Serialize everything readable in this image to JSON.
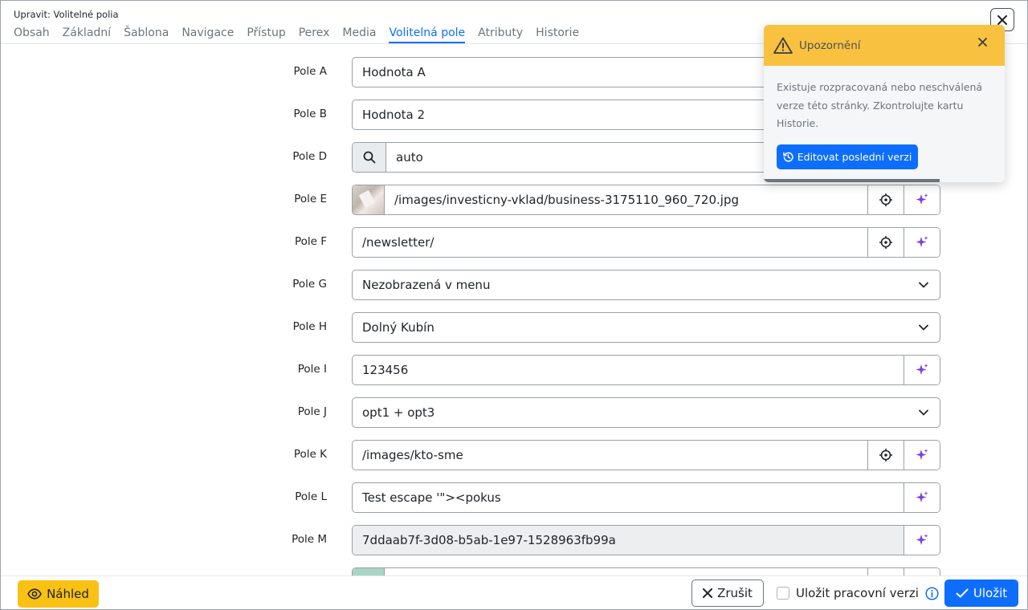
{
  "window": {
    "title": "Upravit: Volitelné polia"
  },
  "tabs": [
    {
      "label": "Obsah",
      "active": false
    },
    {
      "label": "Základní",
      "active": false
    },
    {
      "label": "Šablona",
      "active": false
    },
    {
      "label": "Navigace",
      "active": false
    },
    {
      "label": "Přístup",
      "active": false
    },
    {
      "label": "Perex",
      "active": false
    },
    {
      "label": "Media",
      "active": false
    },
    {
      "label": "Volitelná pole",
      "active": true
    },
    {
      "label": "Atributy",
      "active": false
    },
    {
      "label": "Historie",
      "active": false
    }
  ],
  "fields": {
    "a": {
      "label": "Pole A",
      "value": "Hodnota A"
    },
    "b": {
      "label": "Pole B",
      "value": "Hodnota 2"
    },
    "d": {
      "label": "Pole D",
      "value": "auto"
    },
    "e": {
      "label": "Pole E",
      "value": "/images/investicny-vklad/business-3175110_960_720.jpg"
    },
    "f": {
      "label": "Pole F",
      "value": "/newsletter/"
    },
    "g": {
      "label": "Pole G",
      "value": "Nezobrazená v menu"
    },
    "h": {
      "label": "Pole H",
      "value": "Dolný Kubín"
    },
    "i": {
      "label": "Pole I",
      "value": "123456"
    },
    "j": {
      "label": "Pole J",
      "value": "opt1 + opt3"
    },
    "k": {
      "label": "Pole K",
      "value": "/images/kto-sme"
    },
    "l": {
      "label": "Pole L",
      "value": "Test escape '\"><pokus"
    },
    "m": {
      "label": "Pole M",
      "value": "7ddaab7f-3d08-b5ab-1e97-1528963fb99a"
    }
  },
  "toast": {
    "title": "Upozornění",
    "message": "Existuje rozpracovaná nebo neschválená verze této stránky. Zkontrolujte kartu Historie.",
    "button_label": "Editovat poslední verzi"
  },
  "footer": {
    "preview_label": "Náhled",
    "cancel_label": "Zrušit",
    "save_draft_label": "Uložit pracovní verzi",
    "save_label": "Uložit"
  },
  "colors": {
    "primary": "#0d6efd",
    "warning": "#f8c240",
    "preview": "#f8c113",
    "ai_icon": "#7b3fe4"
  },
  "icons": [
    "close-icon",
    "search-icon",
    "crosshair-icon",
    "sparkle-icon",
    "chevron-down-icon",
    "warning-icon",
    "history-icon",
    "eye-icon",
    "check-icon",
    "info-icon"
  ]
}
